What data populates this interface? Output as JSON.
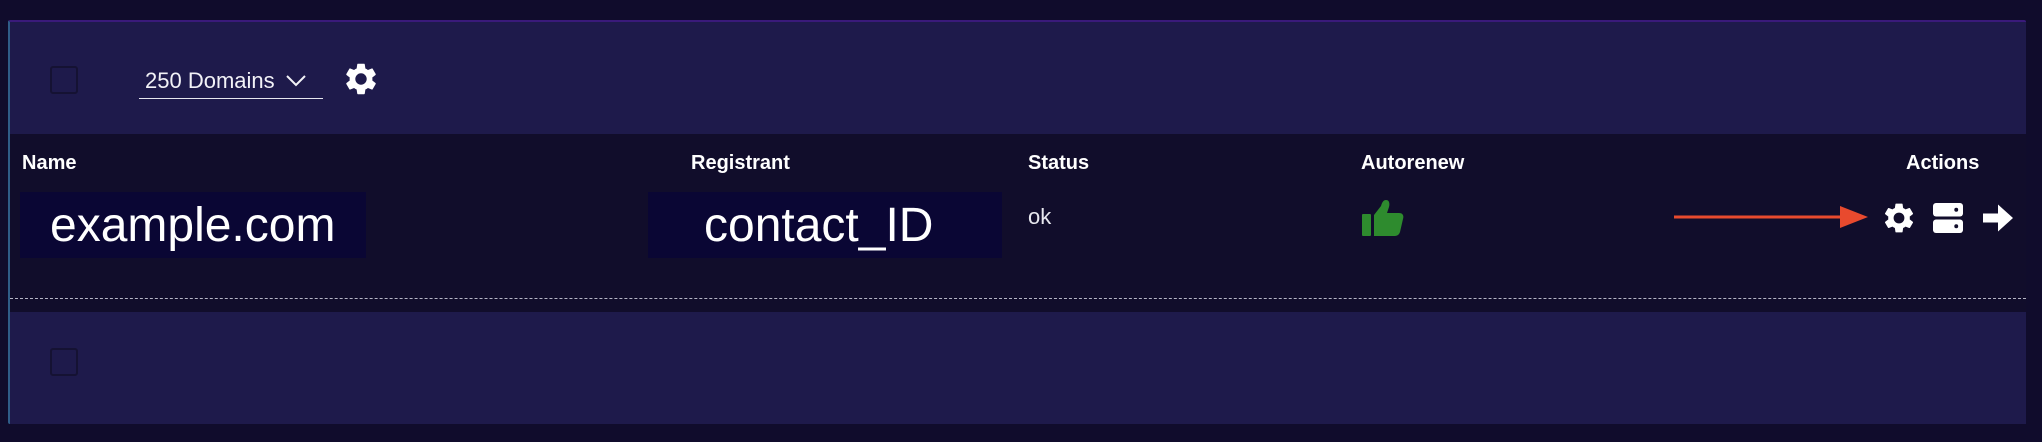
{
  "toolbar": {
    "domain_count_select": "250 Domains"
  },
  "table": {
    "columns": {
      "name": "Name",
      "registrant": "Registrant",
      "status": "Status",
      "autorenew": "Autorenew",
      "actions": "Actions"
    },
    "rows": [
      {
        "name": "example.com",
        "registrant": "contact_ID",
        "status": "ok",
        "autorenew": "thumbs-up-icon",
        "actions": [
          "gear-icon",
          "server-icon",
          "arrow-right-icon"
        ]
      }
    ]
  },
  "colors": {
    "background": "#100c2c",
    "panel": "#1e1a4b",
    "table_bg": "#110d2b",
    "thumb_green": "#2e8b2e",
    "annotation_arrow": "#e84a2e"
  }
}
